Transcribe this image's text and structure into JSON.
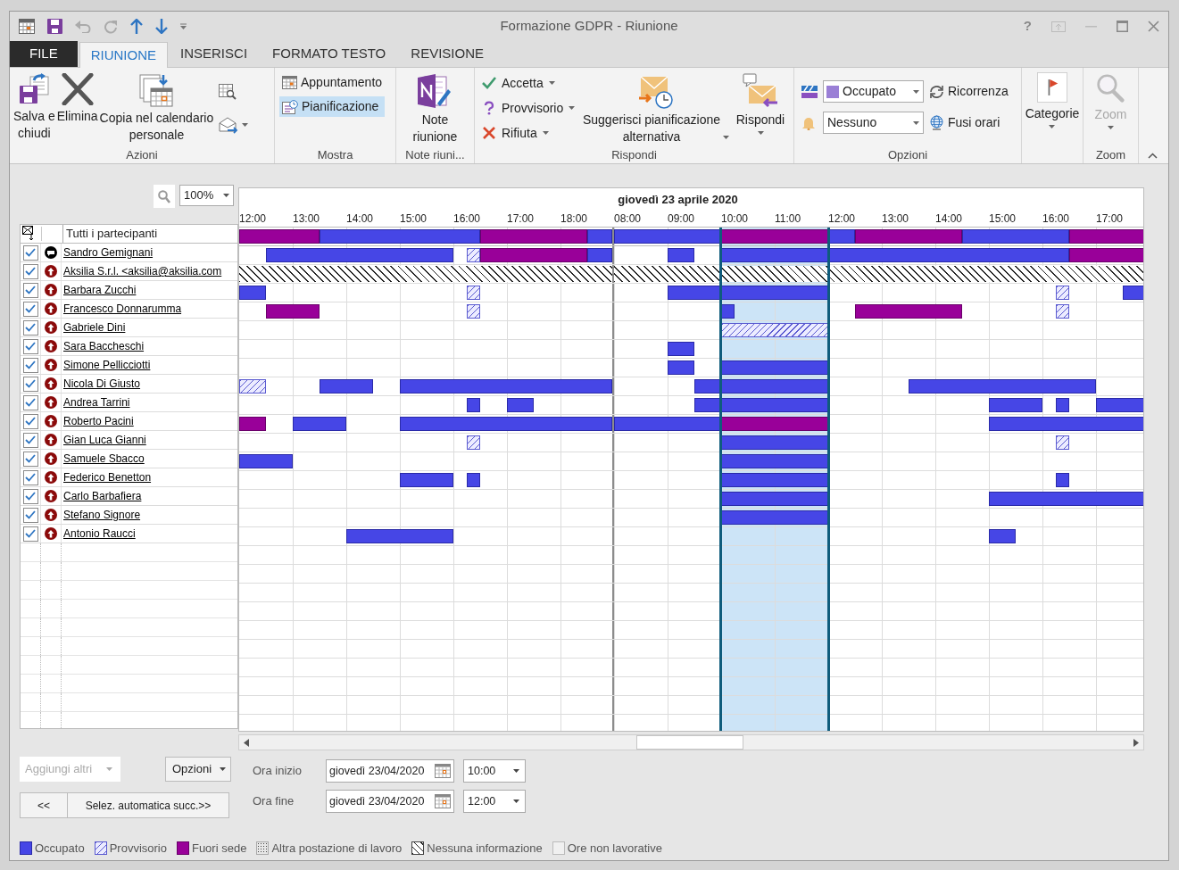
{
  "window": {
    "title": "Formazione GDPR - Riunione",
    "help_glyph": "?"
  },
  "tabs": [
    {
      "label": "FILE",
      "kind": "file",
      "selected": false
    },
    {
      "label": "RIUNIONE",
      "kind": "tab",
      "selected": true
    },
    {
      "label": "INSERISCI",
      "kind": "tab",
      "selected": false
    },
    {
      "label": "FORMATO TESTO",
      "kind": "tab",
      "selected": false
    },
    {
      "label": "REVISIONE",
      "kind": "tab",
      "selected": false
    }
  ],
  "ribbon": {
    "azioni": {
      "label": "Azioni",
      "buttons": [
        {
          "lines": [
            "Salva e",
            "chiudi"
          ],
          "kind": "save"
        },
        {
          "lines": [
            "Elimina"
          ],
          "kind": "delete"
        },
        {
          "lines": [
            "Copia nel calendario",
            "personale"
          ],
          "kind": "copy"
        }
      ]
    },
    "mostra": {
      "label": "Mostra",
      "items": [
        {
          "label": "Appuntamento",
          "selected": false
        },
        {
          "label": "Pianificazione",
          "selected": true
        }
      ]
    },
    "note": {
      "label": "Note riuni...",
      "button": [
        "Note",
        "riunione"
      ]
    },
    "rispondi": {
      "label": "Rispondi",
      "small": [
        {
          "label": "Accetta",
          "kind": "accept"
        },
        {
          "label": "Provvisorio",
          "kind": "tentative"
        },
        {
          "label": "Rifiuta",
          "kind": "decline"
        }
      ],
      "suggest": [
        "Suggerisci pianificazione",
        "alternativa"
      ],
      "reply": "Rispondi"
    },
    "opzioni": {
      "label": "Opzioni",
      "show_as": {
        "value": "Occupato",
        "color": "#9a7fd6"
      },
      "reminder": {
        "value": "Nessuno"
      },
      "recurrence": "Ricorrenza",
      "time_zones": "Fusi orari"
    },
    "categorie": {
      "label": "Categorie"
    },
    "zoom": {
      "label": "Zoom",
      "group_label": "Zoom",
      "disabled": true
    }
  },
  "scheduler": {
    "zoom": "100%",
    "date_heading": "giovedì 23 aprile 2020",
    "days": [
      {
        "hours": [
          "12:00",
          "13:00",
          "14:00",
          "15:00",
          "16:00",
          "17:00",
          "18:00"
        ]
      },
      {
        "hours": [
          "08:00",
          "09:00",
          "10:00",
          "11:00",
          "12:00",
          "13:00",
          "14:00",
          "15:00",
          "16:00",
          "17:00"
        ]
      }
    ],
    "all_row": {
      "label": "Tutti i partecipanti",
      "slots": [
        [
          {
            "kind": "oof"
          },
          {
            "kind": "oof"
          },
          {
            "kind": "oof"
          },
          {
            "kind": "busy"
          },
          {
            "kind": "busy"
          },
          {
            "kind": "busy"
          },
          {
            "kind": "busy"
          },
          {
            "kind": "busy"
          },
          {
            "kind": "busy"
          },
          {
            "kind": "oof"
          },
          {
            "kind": "oof"
          },
          {
            "kind": "oof"
          },
          {
            "kind": "oof"
          },
          {
            "kind": "busy"
          }
        ],
        [
          {
            "kind": "busy"
          },
          {
            "kind": "busy"
          },
          {
            "kind": "busy"
          },
          {
            "kind": "busy"
          },
          {
            "kind": "oof"
          },
          {
            "kind": "oof"
          },
          {
            "kind": "oof"
          },
          {
            "kind": "oof"
          },
          {
            "kind": "busy"
          },
          {
            "kind": "oof"
          },
          {
            "kind": "oof"
          },
          {
            "kind": "oof"
          },
          {
            "kind": "oof"
          },
          {
            "kind": "busy"
          },
          {
            "kind": "busy"
          },
          {
            "kind": "busy"
          },
          {
            "kind": "busy"
          },
          {
            "kind": "oof"
          },
          {
            "kind": "oof"
          },
          {
            "kind": "oof"
          }
        ]
      ]
    },
    "attendees": [
      {
        "name": "Sandro Gemignani",
        "kind": "organizer",
        "checked": true,
        "slots": [
          [
            {
              "kind": "free"
            },
            {
              "kind": "busy"
            },
            {
              "kind": "busy"
            },
            {
              "kind": "busy"
            },
            {
              "kind": "busy"
            },
            {
              "kind": "busy"
            },
            {
              "kind": "busy"
            },
            {
              "kind": "busy"
            },
            {
              "kind": "tent_late"
            },
            {
              "kind": "oof"
            },
            {
              "kind": "oof"
            },
            {
              "kind": "oof"
            },
            {
              "kind": "oof"
            },
            {
              "kind": "busy"
            }
          ],
          [
            {
              "kind": "free"
            },
            {
              "kind": "free"
            },
            {
              "kind": "busy"
            },
            {
              "kind": "free"
            },
            {
              "kind": "busy"
            },
            {
              "kind": "busy"
            },
            {
              "kind": "busy"
            },
            {
              "kind": "busy"
            },
            {
              "kind": "busy"
            },
            {
              "kind": "busy"
            },
            {
              "kind": "busy"
            },
            {
              "kind": "busy"
            },
            {
              "kind": "busy"
            },
            {
              "kind": "busy"
            },
            {
              "kind": "busy"
            },
            {
              "kind": "busy"
            },
            {
              "kind": "busy"
            },
            {
              "kind": "oof"
            },
            {
              "kind": "oof"
            },
            {
              "kind": "oof"
            }
          ]
        ]
      },
      {
        "name": "Aksilia S.r.l. <aksilia@aksilia.com",
        "kind": "required",
        "checked": true,
        "slots": [
          [
            {
              "kind": "none"
            },
            {
              "kind": "none"
            },
            {
              "kind": "none"
            },
            {
              "kind": "none"
            },
            {
              "kind": "none"
            },
            {
              "kind": "none"
            },
            {
              "kind": "none"
            },
            {
              "kind": "none"
            },
            {
              "kind": "none"
            },
            {
              "kind": "none"
            },
            {
              "kind": "none"
            },
            {
              "kind": "none"
            },
            {
              "kind": "none"
            },
            {
              "kind": "none"
            }
          ],
          [
            {
              "kind": "none"
            },
            {
              "kind": "none"
            },
            {
              "kind": "none"
            },
            {
              "kind": "none"
            },
            {
              "kind": "none"
            },
            {
              "kind": "none"
            },
            {
              "kind": "none"
            },
            {
              "kind": "none"
            },
            {
              "kind": "none"
            },
            {
              "kind": "none"
            },
            {
              "kind": "none"
            },
            {
              "kind": "none"
            },
            {
              "kind": "none"
            },
            {
              "kind": "none"
            },
            {
              "kind": "none"
            },
            {
              "kind": "none"
            },
            {
              "kind": "none"
            },
            {
              "kind": "none"
            },
            {
              "kind": "none"
            },
            {
              "kind": "none"
            }
          ]
        ]
      },
      {
        "name": "Barbara Zucchi",
        "kind": "required",
        "checked": true,
        "slots": [
          [
            {
              "kind": "busy"
            },
            {
              "kind": "free"
            },
            {
              "kind": "free"
            },
            {
              "kind": "free"
            },
            {
              "kind": "free"
            },
            {
              "kind": "free"
            },
            {
              "kind": "free"
            },
            {
              "kind": "free"
            },
            {
              "kind": "tent_late"
            },
            {
              "kind": "free"
            },
            {
              "kind": "free"
            },
            {
              "kind": "free"
            },
            {
              "kind": "free"
            },
            {
              "kind": "free"
            }
          ],
          [
            {
              "kind": "free"
            },
            {
              "kind": "free"
            },
            {
              "kind": "busy"
            },
            {
              "kind": "busy"
            },
            {
              "kind": "busy"
            },
            {
              "kind": "busy"
            },
            {
              "kind": "busy"
            },
            {
              "kind": "busy"
            },
            {
              "kind": "free"
            },
            {
              "kind": "free"
            },
            {
              "kind": "free"
            },
            {
              "kind": "free"
            },
            {
              "kind": "free"
            },
            {
              "kind": "free"
            },
            {
              "kind": "free"
            },
            {
              "kind": "free"
            },
            {
              "kind": "tent_late"
            },
            {
              "kind": "free"
            },
            {
              "kind": "free"
            },
            {
              "kind": "busy"
            }
          ]
        ]
      },
      {
        "name": "Francesco Donnarumma",
        "kind": "required",
        "checked": true,
        "slots": [
          [
            {
              "kind": "free"
            },
            {
              "kind": "oof"
            },
            {
              "kind": "oof"
            },
            {
              "kind": "free"
            },
            {
              "kind": "free"
            },
            {
              "kind": "free"
            },
            {
              "kind": "free"
            },
            {
              "kind": "free"
            },
            {
              "kind": "tent_late"
            },
            {
              "kind": "free"
            },
            {
              "kind": "free"
            },
            {
              "kind": "free"
            },
            {
              "kind": "free"
            },
            {
              "kind": "free"
            }
          ],
          [
            {
              "kind": "free"
            },
            {
              "kind": "free"
            },
            {
              "kind": "free"
            },
            {
              "kind": "free"
            },
            {
              "kind": "busy_early"
            },
            {
              "kind": "free"
            },
            {
              "kind": "free"
            },
            {
              "kind": "free"
            },
            {
              "kind": "free"
            },
            {
              "kind": "oof"
            },
            {
              "kind": "oof"
            },
            {
              "kind": "oof"
            },
            {
              "kind": "oof"
            },
            {
              "kind": "free"
            },
            {
              "kind": "free"
            },
            {
              "kind": "free"
            },
            {
              "kind": "tent_late"
            },
            {
              "kind": "free"
            },
            {
              "kind": "free"
            },
            {
              "kind": "free"
            }
          ]
        ]
      },
      {
        "name": "Gabriele Dini",
        "kind": "required",
        "checked": true,
        "slots": [
          [
            {
              "kind": "free"
            },
            {
              "kind": "free"
            },
            {
              "kind": "free"
            },
            {
              "kind": "free"
            },
            {
              "kind": "free"
            },
            {
              "kind": "free"
            },
            {
              "kind": "free"
            },
            {
              "kind": "free"
            },
            {
              "kind": "free"
            },
            {
              "kind": "free"
            },
            {
              "kind": "free"
            },
            {
              "kind": "free"
            },
            {
              "kind": "free"
            },
            {
              "kind": "free"
            }
          ],
          [
            {
              "kind": "free"
            },
            {
              "kind": "free"
            },
            {
              "kind": "free"
            },
            {
              "kind": "free"
            },
            {
              "kind": "tent"
            },
            {
              "kind": "tent"
            },
            {
              "kind": "tent"
            },
            {
              "kind": "tent"
            },
            {
              "kind": "free"
            },
            {
              "kind": "free"
            },
            {
              "kind": "free"
            },
            {
              "kind": "free"
            },
            {
              "kind": "free"
            },
            {
              "kind": "free"
            },
            {
              "kind": "free"
            },
            {
              "kind": "free"
            },
            {
              "kind": "free"
            },
            {
              "kind": "free"
            },
            {
              "kind": "free"
            },
            {
              "kind": "free"
            }
          ]
        ]
      },
      {
        "name": "Sara Baccheschi",
        "kind": "required",
        "checked": true,
        "slots": [
          [
            {
              "kind": "free"
            },
            {
              "kind": "free"
            },
            {
              "kind": "free"
            },
            {
              "kind": "free"
            },
            {
              "kind": "free"
            },
            {
              "kind": "free"
            },
            {
              "kind": "free"
            },
            {
              "kind": "free"
            },
            {
              "kind": "free"
            },
            {
              "kind": "free"
            },
            {
              "kind": "free"
            },
            {
              "kind": "free"
            },
            {
              "kind": "free"
            },
            {
              "kind": "free"
            }
          ],
          [
            {
              "kind": "free"
            },
            {
              "kind": "free"
            },
            {
              "kind": "busy"
            },
            {
              "kind": "free"
            },
            {
              "kind": "free"
            },
            {
              "kind": "free"
            },
            {
              "kind": "free"
            },
            {
              "kind": "free"
            },
            {
              "kind": "free"
            },
            {
              "kind": "free"
            },
            {
              "kind": "free"
            },
            {
              "kind": "free"
            },
            {
              "kind": "free"
            },
            {
              "kind": "free"
            },
            {
              "kind": "free"
            },
            {
              "kind": "free"
            },
            {
              "kind": "free"
            },
            {
              "kind": "free"
            },
            {
              "kind": "free"
            },
            {
              "kind": "free"
            }
          ]
        ]
      },
      {
        "name": "Simone Pellicciotti",
        "kind": "required",
        "checked": true,
        "slots": [
          [
            {
              "kind": "free"
            },
            {
              "kind": "free"
            },
            {
              "kind": "free"
            },
            {
              "kind": "free"
            },
            {
              "kind": "free"
            },
            {
              "kind": "free"
            },
            {
              "kind": "free"
            },
            {
              "kind": "free"
            },
            {
              "kind": "free"
            },
            {
              "kind": "free"
            },
            {
              "kind": "free"
            },
            {
              "kind": "free"
            },
            {
              "kind": "free"
            },
            {
              "kind": "free"
            }
          ],
          [
            {
              "kind": "free"
            },
            {
              "kind": "free"
            },
            {
              "kind": "busy"
            },
            {
              "kind": "free"
            },
            {
              "kind": "busy"
            },
            {
              "kind": "busy"
            },
            {
              "kind": "busy"
            },
            {
              "kind": "busy"
            },
            {
              "kind": "free"
            },
            {
              "kind": "free"
            },
            {
              "kind": "free"
            },
            {
              "kind": "free"
            },
            {
              "kind": "free"
            },
            {
              "kind": "free"
            },
            {
              "kind": "free"
            },
            {
              "kind": "free"
            },
            {
              "kind": "free"
            },
            {
              "kind": "free"
            },
            {
              "kind": "free"
            },
            {
              "kind": "free"
            }
          ]
        ]
      },
      {
        "name": "Nicola Di Giusto",
        "kind": "required",
        "checked": true,
        "slots": [
          [
            {
              "kind": "tent"
            },
            {
              "kind": "free"
            },
            {
              "kind": "free"
            },
            {
              "kind": "busy"
            },
            {
              "kind": "busy"
            },
            {
              "kind": "free"
            },
            {
              "kind": "busy"
            },
            {
              "kind": "busy"
            },
            {
              "kind": "busy"
            },
            {
              "kind": "busy"
            },
            {
              "kind": "busy"
            },
            {
              "kind": "busy"
            },
            {
              "kind": "busy"
            },
            {
              "kind": "busy"
            }
          ],
          [
            {
              "kind": "free"
            },
            {
              "kind": "free"
            },
            {
              "kind": "free"
            },
            {
              "kind": "busy"
            },
            {
              "kind": "busy"
            },
            {
              "kind": "busy"
            },
            {
              "kind": "busy"
            },
            {
              "kind": "busy"
            },
            {
              "kind": "free"
            },
            {
              "kind": "free"
            },
            {
              "kind": "free"
            },
            {
              "kind": "busy"
            },
            {
              "kind": "busy"
            },
            {
              "kind": "busy"
            },
            {
              "kind": "busy"
            },
            {
              "kind": "busy"
            },
            {
              "kind": "busy"
            },
            {
              "kind": "busy"
            },
            {
              "kind": "free"
            },
            {
              "kind": "free"
            }
          ]
        ]
      },
      {
        "name": "Andrea Tarrini",
        "kind": "required",
        "checked": true,
        "slots": [
          [
            {
              "kind": "free"
            },
            {
              "kind": "free"
            },
            {
              "kind": "free"
            },
            {
              "kind": "free"
            },
            {
              "kind": "free"
            },
            {
              "kind": "free"
            },
            {
              "kind": "free"
            },
            {
              "kind": "free"
            },
            {
              "kind": "busy_late"
            },
            {
              "kind": "free"
            },
            {
              "kind": "busy"
            },
            {
              "kind": "free"
            },
            {
              "kind": "free"
            },
            {
              "kind": "free"
            }
          ],
          [
            {
              "kind": "free"
            },
            {
              "kind": "free"
            },
            {
              "kind": "free"
            },
            {
              "kind": "busy"
            },
            {
              "kind": "busy"
            },
            {
              "kind": "busy"
            },
            {
              "kind": "busy"
            },
            {
              "kind": "busy"
            },
            {
              "kind": "free"
            },
            {
              "kind": "free"
            },
            {
              "kind": "free"
            },
            {
              "kind": "free"
            },
            {
              "kind": "free"
            },
            {
              "kind": "free"
            },
            {
              "kind": "busy"
            },
            {
              "kind": "busy"
            },
            {
              "kind": "busy_late"
            },
            {
              "kind": "free"
            },
            {
              "kind": "busy"
            },
            {
              "kind": "busy"
            }
          ]
        ]
      },
      {
        "name": "Roberto Pacini",
        "kind": "required",
        "checked": true,
        "slots": [
          [
            {
              "kind": "oof"
            },
            {
              "kind": "free"
            },
            {
              "kind": "busy"
            },
            {
              "kind": "busy"
            },
            {
              "kind": "free"
            },
            {
              "kind": "free"
            },
            {
              "kind": "busy"
            },
            {
              "kind": "busy"
            },
            {
              "kind": "busy"
            },
            {
              "kind": "busy"
            },
            {
              "kind": "busy"
            },
            {
              "kind": "busy"
            },
            {
              "kind": "busy"
            },
            {
              "kind": "busy"
            }
          ],
          [
            {
              "kind": "busy"
            },
            {
              "kind": "busy"
            },
            {
              "kind": "busy"
            },
            {
              "kind": "busy"
            },
            {
              "kind": "oof"
            },
            {
              "kind": "oof"
            },
            {
              "kind": "oof"
            },
            {
              "kind": "oof"
            },
            {
              "kind": "free"
            },
            {
              "kind": "free"
            },
            {
              "kind": "free"
            },
            {
              "kind": "free"
            },
            {
              "kind": "free"
            },
            {
              "kind": "free"
            },
            {
              "kind": "busy"
            },
            {
              "kind": "busy"
            },
            {
              "kind": "busy"
            },
            {
              "kind": "busy"
            },
            {
              "kind": "busy"
            },
            {
              "kind": "busy"
            }
          ]
        ]
      },
      {
        "name": "Gian Luca Gianni",
        "kind": "required",
        "checked": true,
        "slots": [
          [
            {
              "kind": "free"
            },
            {
              "kind": "free"
            },
            {
              "kind": "free"
            },
            {
              "kind": "free"
            },
            {
              "kind": "free"
            },
            {
              "kind": "free"
            },
            {
              "kind": "free"
            },
            {
              "kind": "free"
            },
            {
              "kind": "tent_late"
            },
            {
              "kind": "free"
            },
            {
              "kind": "free"
            },
            {
              "kind": "free"
            },
            {
              "kind": "free"
            },
            {
              "kind": "free"
            }
          ],
          [
            {
              "kind": "free"
            },
            {
              "kind": "free"
            },
            {
              "kind": "free"
            },
            {
              "kind": "free"
            },
            {
              "kind": "busy"
            },
            {
              "kind": "busy"
            },
            {
              "kind": "busy"
            },
            {
              "kind": "busy"
            },
            {
              "kind": "free"
            },
            {
              "kind": "free"
            },
            {
              "kind": "free"
            },
            {
              "kind": "free"
            },
            {
              "kind": "free"
            },
            {
              "kind": "free"
            },
            {
              "kind": "free"
            },
            {
              "kind": "free"
            },
            {
              "kind": "tent_late"
            },
            {
              "kind": "free"
            },
            {
              "kind": "free"
            },
            {
              "kind": "free"
            }
          ]
        ]
      },
      {
        "name": "Samuele Sbacco",
        "kind": "required",
        "checked": true,
        "slots": [
          [
            {
              "kind": "busy"
            },
            {
              "kind": "busy"
            },
            {
              "kind": "free"
            },
            {
              "kind": "free"
            },
            {
              "kind": "free"
            },
            {
              "kind": "free"
            },
            {
              "kind": "free"
            },
            {
              "kind": "free"
            },
            {
              "kind": "free"
            },
            {
              "kind": "free"
            },
            {
              "kind": "free"
            },
            {
              "kind": "free"
            },
            {
              "kind": "free"
            },
            {
              "kind": "free"
            }
          ],
          [
            {
              "kind": "free"
            },
            {
              "kind": "free"
            },
            {
              "kind": "free"
            },
            {
              "kind": "free"
            },
            {
              "kind": "busy"
            },
            {
              "kind": "busy"
            },
            {
              "kind": "busy"
            },
            {
              "kind": "busy"
            },
            {
              "kind": "free"
            },
            {
              "kind": "free"
            },
            {
              "kind": "free"
            },
            {
              "kind": "free"
            },
            {
              "kind": "free"
            },
            {
              "kind": "free"
            },
            {
              "kind": "free"
            },
            {
              "kind": "free"
            },
            {
              "kind": "free"
            },
            {
              "kind": "free"
            },
            {
              "kind": "free"
            },
            {
              "kind": "free"
            }
          ]
        ]
      },
      {
        "name": "Federico Benetton",
        "kind": "required",
        "checked": true,
        "slots": [
          [
            {
              "kind": "free"
            },
            {
              "kind": "free"
            },
            {
              "kind": "free"
            },
            {
              "kind": "free"
            },
            {
              "kind": "free"
            },
            {
              "kind": "free"
            },
            {
              "kind": "busy"
            },
            {
              "kind": "busy"
            },
            {
              "kind": "busy_late"
            },
            {
              "kind": "free"
            },
            {
              "kind": "free"
            },
            {
              "kind": "free"
            },
            {
              "kind": "free"
            },
            {
              "kind": "free"
            }
          ],
          [
            {
              "kind": "free"
            },
            {
              "kind": "free"
            },
            {
              "kind": "free"
            },
            {
              "kind": "free"
            },
            {
              "kind": "busy"
            },
            {
              "kind": "busy"
            },
            {
              "kind": "busy"
            },
            {
              "kind": "busy"
            },
            {
              "kind": "free"
            },
            {
              "kind": "free"
            },
            {
              "kind": "free"
            },
            {
              "kind": "free"
            },
            {
              "kind": "free"
            },
            {
              "kind": "free"
            },
            {
              "kind": "free"
            },
            {
              "kind": "free"
            },
            {
              "kind": "busy_late"
            },
            {
              "kind": "free"
            },
            {
              "kind": "free"
            },
            {
              "kind": "free"
            }
          ]
        ]
      },
      {
        "name": "Carlo Barbafiera",
        "kind": "required",
        "checked": true,
        "slots": [
          [
            {
              "kind": "free"
            },
            {
              "kind": "free"
            },
            {
              "kind": "free"
            },
            {
              "kind": "free"
            },
            {
              "kind": "free"
            },
            {
              "kind": "free"
            },
            {
              "kind": "free"
            },
            {
              "kind": "free"
            },
            {
              "kind": "free"
            },
            {
              "kind": "free"
            },
            {
              "kind": "free"
            },
            {
              "kind": "free"
            },
            {
              "kind": "free"
            },
            {
              "kind": "free"
            }
          ],
          [
            {
              "kind": "free"
            },
            {
              "kind": "free"
            },
            {
              "kind": "free"
            },
            {
              "kind": "free"
            },
            {
              "kind": "busy"
            },
            {
              "kind": "busy"
            },
            {
              "kind": "busy"
            },
            {
              "kind": "busy"
            },
            {
              "kind": "free"
            },
            {
              "kind": "free"
            },
            {
              "kind": "free"
            },
            {
              "kind": "free"
            },
            {
              "kind": "free"
            },
            {
              "kind": "free"
            },
            {
              "kind": "busy"
            },
            {
              "kind": "busy"
            },
            {
              "kind": "busy"
            },
            {
              "kind": "busy"
            },
            {
              "kind": "busy"
            },
            {
              "kind": "busy"
            }
          ]
        ]
      },
      {
        "name": "Stefano Signore",
        "kind": "required",
        "checked": true,
        "slots": [
          [
            {
              "kind": "free"
            },
            {
              "kind": "free"
            },
            {
              "kind": "free"
            },
            {
              "kind": "free"
            },
            {
              "kind": "free"
            },
            {
              "kind": "free"
            },
            {
              "kind": "free"
            },
            {
              "kind": "free"
            },
            {
              "kind": "free"
            },
            {
              "kind": "free"
            },
            {
              "kind": "free"
            },
            {
              "kind": "free"
            },
            {
              "kind": "free"
            },
            {
              "kind": "free"
            }
          ],
          [
            {
              "kind": "free"
            },
            {
              "kind": "free"
            },
            {
              "kind": "free"
            },
            {
              "kind": "free"
            },
            {
              "kind": "busy"
            },
            {
              "kind": "busy"
            },
            {
              "kind": "busy"
            },
            {
              "kind": "busy"
            },
            {
              "kind": "free"
            },
            {
              "kind": "free"
            },
            {
              "kind": "free"
            },
            {
              "kind": "free"
            },
            {
              "kind": "free"
            },
            {
              "kind": "free"
            },
            {
              "kind": "free"
            },
            {
              "kind": "free"
            },
            {
              "kind": "free"
            },
            {
              "kind": "free"
            },
            {
              "kind": "free"
            },
            {
              "kind": "free"
            }
          ]
        ]
      },
      {
        "name": "Antonio Raucci",
        "kind": "required",
        "checked": true,
        "slots": [
          [
            {
              "kind": "free"
            },
            {
              "kind": "free"
            },
            {
              "kind": "free"
            },
            {
              "kind": "free"
            },
            {
              "kind": "busy"
            },
            {
              "kind": "busy"
            },
            {
              "kind": "busy"
            },
            {
              "kind": "busy"
            },
            {
              "kind": "free"
            },
            {
              "kind": "free"
            },
            {
              "kind": "free"
            },
            {
              "kind": "free"
            },
            {
              "kind": "free"
            },
            {
              "kind": "free"
            }
          ],
          [
            {
              "kind": "free"
            },
            {
              "kind": "free"
            },
            {
              "kind": "free"
            },
            {
              "kind": "free"
            },
            {
              "kind": "free"
            },
            {
              "kind": "free"
            },
            {
              "kind": "free"
            },
            {
              "kind": "free"
            },
            {
              "kind": "free"
            },
            {
              "kind": "free"
            },
            {
              "kind": "free"
            },
            {
              "kind": "free"
            },
            {
              "kind": "free"
            },
            {
              "kind": "free"
            },
            {
              "kind": "busy"
            },
            {
              "kind": "free"
            },
            {
              "kind": "free"
            },
            {
              "kind": "free"
            },
            {
              "kind": "free"
            },
            {
              "kind": "free"
            }
          ]
        ]
      }
    ]
  },
  "bottom": {
    "add_others": {
      "label": "Aggiungi altri",
      "disabled": true
    },
    "options": "Opzioni",
    "previous": "<<",
    "auto_pick": "Selez. automatica succ.>>",
    "start": {
      "label": "Ora inizio",
      "date": "giovedì 23/04/2020",
      "time": "10:00"
    },
    "end": {
      "label": "Ora fine",
      "date": "giovedì 23/04/2020",
      "time": "12:00"
    }
  },
  "legend": [
    {
      "label": "Occupato",
      "kind": "busy"
    },
    {
      "label": "Provvisorio",
      "kind": "tent"
    },
    {
      "label": "Fuori sede",
      "kind": "oof"
    },
    {
      "label": "Altra postazione di lavoro",
      "kind": "elsewhere"
    },
    {
      "label": "Nessuna informazione",
      "kind": "none"
    },
    {
      "label": "Ore non lavorative",
      "kind": "nonworking"
    }
  ]
}
